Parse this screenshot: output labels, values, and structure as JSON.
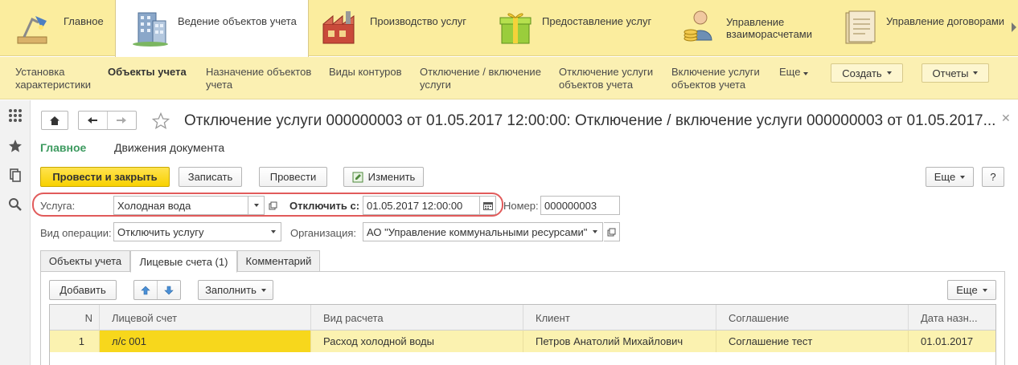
{
  "sections": [
    {
      "label": "Главное",
      "icon": "desk-lamp-icon"
    },
    {
      "label": "Ведение объектов учета",
      "icon": "building-icon"
    },
    {
      "label": "Производство услуг",
      "icon": "factory-icon"
    },
    {
      "label": "Предоставление услуг",
      "icon": "gift-box-icon"
    },
    {
      "label_line1": "Управление",
      "label_line2": "взаиморасчетами",
      "icon": "accountant-icon"
    },
    {
      "label": "Управление договорами",
      "icon": "contract-folder-icon"
    }
  ],
  "functions": {
    "item1": [
      "Установка",
      "характеристики"
    ],
    "item2": "Объекты учета",
    "item3": [
      "Назначение объектов",
      "учета"
    ],
    "item4": "Виды контуров",
    "item5": [
      "Отключение / включение",
      "услуги"
    ],
    "item6": [
      "Отключение услуги",
      "объектов учета"
    ],
    "item7": [
      "Включение услуги",
      "объектов учета"
    ],
    "more": "Еще",
    "create": "Создать",
    "reports": "Отчеты"
  },
  "form": {
    "title": "Отключение услуги 000000003 от 01.05.2017 12:00:00: Отключение / включение услуги 000000003 от 01.05.2017...",
    "tab_main": "Главное",
    "tab_movements": "Движения документа",
    "btn_post_close": "Провести и закрыть",
    "btn_write": "Записать",
    "btn_post": "Провести",
    "btn_edit": "Изменить",
    "btn_more": "Еще",
    "btn_help": "?"
  },
  "fields": {
    "service_label": "Услуга:",
    "service_value": "Холодная вода",
    "disable_from_label": "Отключить с:",
    "disable_from_value": "01.05.2017 12:00:00",
    "number_label": "Номер:",
    "number_value": "000000003",
    "operation_label": "Вид операции:",
    "operation_value": "Отключить услугу",
    "org_label": "Организация:",
    "org_value": "АО \"Управление коммунальными ресурсами\""
  },
  "tabs": [
    "Объекты учета",
    "Лицевые счета (1)",
    "Комментарий"
  ],
  "table_toolbar": {
    "add": "Добавить",
    "fill": "Заполнить",
    "more": "Еще"
  },
  "table": {
    "headers": [
      "N",
      "Лицевой счет",
      "Вид расчета",
      "Клиент",
      "Соглашение",
      "Дата назн..."
    ],
    "rows": [
      [
        "1",
        "л/с 001",
        "Расход холодной воды",
        "Петров Анатолий Михайлович",
        "Соглашение тест",
        "01.01.2017"
      ]
    ]
  },
  "colors": {
    "accent_yellow": "#f8d100",
    "section_bg": "#fbed9e",
    "tab_green": "#3c9a5f",
    "highlight_red": "#e15b5b"
  }
}
